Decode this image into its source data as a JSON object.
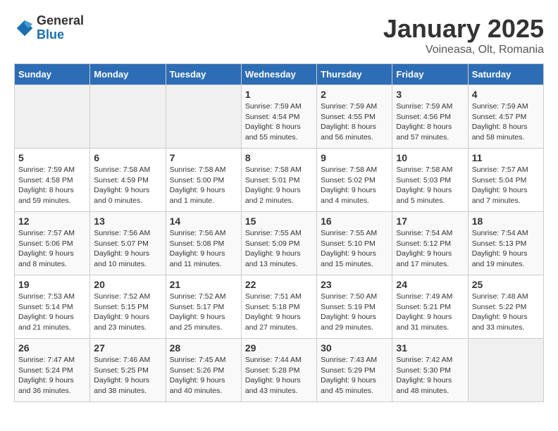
{
  "header": {
    "logo_general": "General",
    "logo_blue": "Blue",
    "title": "January 2025",
    "subtitle": "Voineasa, Olt, Romania"
  },
  "days_of_week": [
    "Sunday",
    "Monday",
    "Tuesday",
    "Wednesday",
    "Thursday",
    "Friday",
    "Saturday"
  ],
  "weeks": [
    [
      {
        "day": "",
        "info": ""
      },
      {
        "day": "",
        "info": ""
      },
      {
        "day": "",
        "info": ""
      },
      {
        "day": "1",
        "info": "Sunrise: 7:59 AM\nSunset: 4:54 PM\nDaylight: 8 hours\nand 55 minutes."
      },
      {
        "day": "2",
        "info": "Sunrise: 7:59 AM\nSunset: 4:55 PM\nDaylight: 8 hours\nand 56 minutes."
      },
      {
        "day": "3",
        "info": "Sunrise: 7:59 AM\nSunset: 4:56 PM\nDaylight: 8 hours\nand 57 minutes."
      },
      {
        "day": "4",
        "info": "Sunrise: 7:59 AM\nSunset: 4:57 PM\nDaylight: 8 hours\nand 58 minutes."
      }
    ],
    [
      {
        "day": "5",
        "info": "Sunrise: 7:59 AM\nSunset: 4:58 PM\nDaylight: 8 hours\nand 59 minutes."
      },
      {
        "day": "6",
        "info": "Sunrise: 7:58 AM\nSunset: 4:59 PM\nDaylight: 9 hours\nand 0 minutes."
      },
      {
        "day": "7",
        "info": "Sunrise: 7:58 AM\nSunset: 5:00 PM\nDaylight: 9 hours\nand 1 minute."
      },
      {
        "day": "8",
        "info": "Sunrise: 7:58 AM\nSunset: 5:01 PM\nDaylight: 9 hours\nand 2 minutes."
      },
      {
        "day": "9",
        "info": "Sunrise: 7:58 AM\nSunset: 5:02 PM\nDaylight: 9 hours\nand 4 minutes."
      },
      {
        "day": "10",
        "info": "Sunrise: 7:58 AM\nSunset: 5:03 PM\nDaylight: 9 hours\nand 5 minutes."
      },
      {
        "day": "11",
        "info": "Sunrise: 7:57 AM\nSunset: 5:04 PM\nDaylight: 9 hours\nand 7 minutes."
      }
    ],
    [
      {
        "day": "12",
        "info": "Sunrise: 7:57 AM\nSunset: 5:06 PM\nDaylight: 9 hours\nand 8 minutes."
      },
      {
        "day": "13",
        "info": "Sunrise: 7:56 AM\nSunset: 5:07 PM\nDaylight: 9 hours\nand 10 minutes."
      },
      {
        "day": "14",
        "info": "Sunrise: 7:56 AM\nSunset: 5:08 PM\nDaylight: 9 hours\nand 11 minutes."
      },
      {
        "day": "15",
        "info": "Sunrise: 7:55 AM\nSunset: 5:09 PM\nDaylight: 9 hours\nand 13 minutes."
      },
      {
        "day": "16",
        "info": "Sunrise: 7:55 AM\nSunset: 5:10 PM\nDaylight: 9 hours\nand 15 minutes."
      },
      {
        "day": "17",
        "info": "Sunrise: 7:54 AM\nSunset: 5:12 PM\nDaylight: 9 hours\nand 17 minutes."
      },
      {
        "day": "18",
        "info": "Sunrise: 7:54 AM\nSunset: 5:13 PM\nDaylight: 9 hours\nand 19 minutes."
      }
    ],
    [
      {
        "day": "19",
        "info": "Sunrise: 7:53 AM\nSunset: 5:14 PM\nDaylight: 9 hours\nand 21 minutes."
      },
      {
        "day": "20",
        "info": "Sunrise: 7:52 AM\nSunset: 5:15 PM\nDaylight: 9 hours\nand 23 minutes."
      },
      {
        "day": "21",
        "info": "Sunrise: 7:52 AM\nSunset: 5:17 PM\nDaylight: 9 hours\nand 25 minutes."
      },
      {
        "day": "22",
        "info": "Sunrise: 7:51 AM\nSunset: 5:18 PM\nDaylight: 9 hours\nand 27 minutes."
      },
      {
        "day": "23",
        "info": "Sunrise: 7:50 AM\nSunset: 5:19 PM\nDaylight: 9 hours\nand 29 minutes."
      },
      {
        "day": "24",
        "info": "Sunrise: 7:49 AM\nSunset: 5:21 PM\nDaylight: 9 hours\nand 31 minutes."
      },
      {
        "day": "25",
        "info": "Sunrise: 7:48 AM\nSunset: 5:22 PM\nDaylight: 9 hours\nand 33 minutes."
      }
    ],
    [
      {
        "day": "26",
        "info": "Sunrise: 7:47 AM\nSunset: 5:24 PM\nDaylight: 9 hours\nand 36 minutes."
      },
      {
        "day": "27",
        "info": "Sunrise: 7:46 AM\nSunset: 5:25 PM\nDaylight: 9 hours\nand 38 minutes."
      },
      {
        "day": "28",
        "info": "Sunrise: 7:45 AM\nSunset: 5:26 PM\nDaylight: 9 hours\nand 40 minutes."
      },
      {
        "day": "29",
        "info": "Sunrise: 7:44 AM\nSunset: 5:28 PM\nDaylight: 9 hours\nand 43 minutes."
      },
      {
        "day": "30",
        "info": "Sunrise: 7:43 AM\nSunset: 5:29 PM\nDaylight: 9 hours\nand 45 minutes."
      },
      {
        "day": "31",
        "info": "Sunrise: 7:42 AM\nSunset: 5:30 PM\nDaylight: 9 hours\nand 48 minutes."
      },
      {
        "day": "",
        "info": ""
      }
    ]
  ]
}
